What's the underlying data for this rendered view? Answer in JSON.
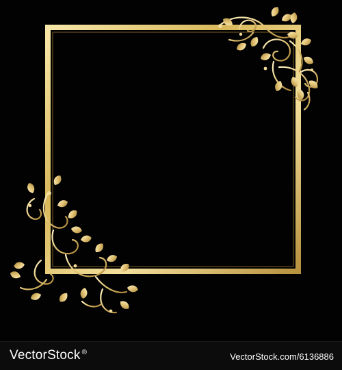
{
  "artwork": {
    "background_color": "#020202",
    "frame_color": "#e6c86e",
    "ornament_color": "#e8cf86",
    "icons": [
      "decorative-square-frame",
      "floral-swirl-corner-top-right",
      "floral-swirl-corner-bottom-left"
    ]
  },
  "footer": {
    "brand": "VectorStock",
    "trademark": "®",
    "credit": "VectorStock.com/6136886",
    "background_color": "#0c0c0c",
    "text_color": "#ffffff"
  }
}
